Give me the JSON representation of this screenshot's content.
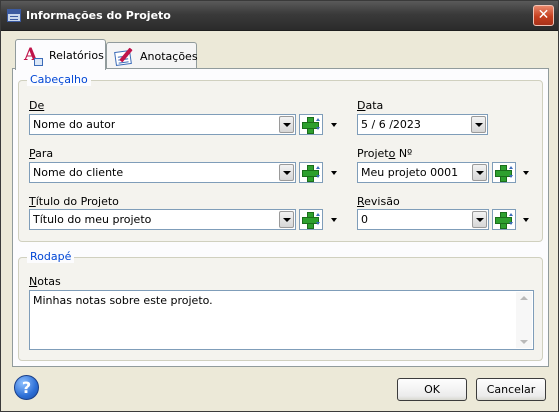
{
  "window": {
    "title": "Informações do Projeto",
    "close_glyph": "✕"
  },
  "tabs": [
    {
      "label": "Relatórios",
      "icon": "report-icon",
      "active": true
    },
    {
      "label": "Anotações",
      "icon": "notes-icon",
      "active": false
    }
  ],
  "header_group": {
    "title": "Cabeçalho",
    "de": {
      "label_underlined": "De",
      "label_rest": "",
      "value": "Nome do autor"
    },
    "para": {
      "label_underlined": "P",
      "label_rest": "ara",
      "value": "Nome do cliente"
    },
    "titulo": {
      "label_underlined": "T",
      "label_rest": "ítulo do Projeto",
      "value": "Título do meu projeto"
    },
    "data": {
      "label_underlined": "D",
      "label_rest": "ata",
      "value": "5 / 6 /2023"
    },
    "projeto": {
      "label_prefix": "Projet",
      "label_underlined": "o",
      "label_rest": " Nº",
      "value": "Meu projeto 0001"
    },
    "revisao": {
      "label_underlined": "R",
      "label_rest": "evisão",
      "value": "0"
    }
  },
  "footer_group": {
    "title": "Rodapé",
    "notas": {
      "label_underlined": "N",
      "label_rest": "otas",
      "value": "Minhas notas sobre este projeto."
    }
  },
  "buttons": {
    "ok": "OK",
    "cancel": "Cancelar",
    "help_glyph": "?"
  },
  "colors": {
    "group_title": "#0046d5",
    "add_icon": "#2ea02e",
    "close_button": "#c6401f"
  }
}
